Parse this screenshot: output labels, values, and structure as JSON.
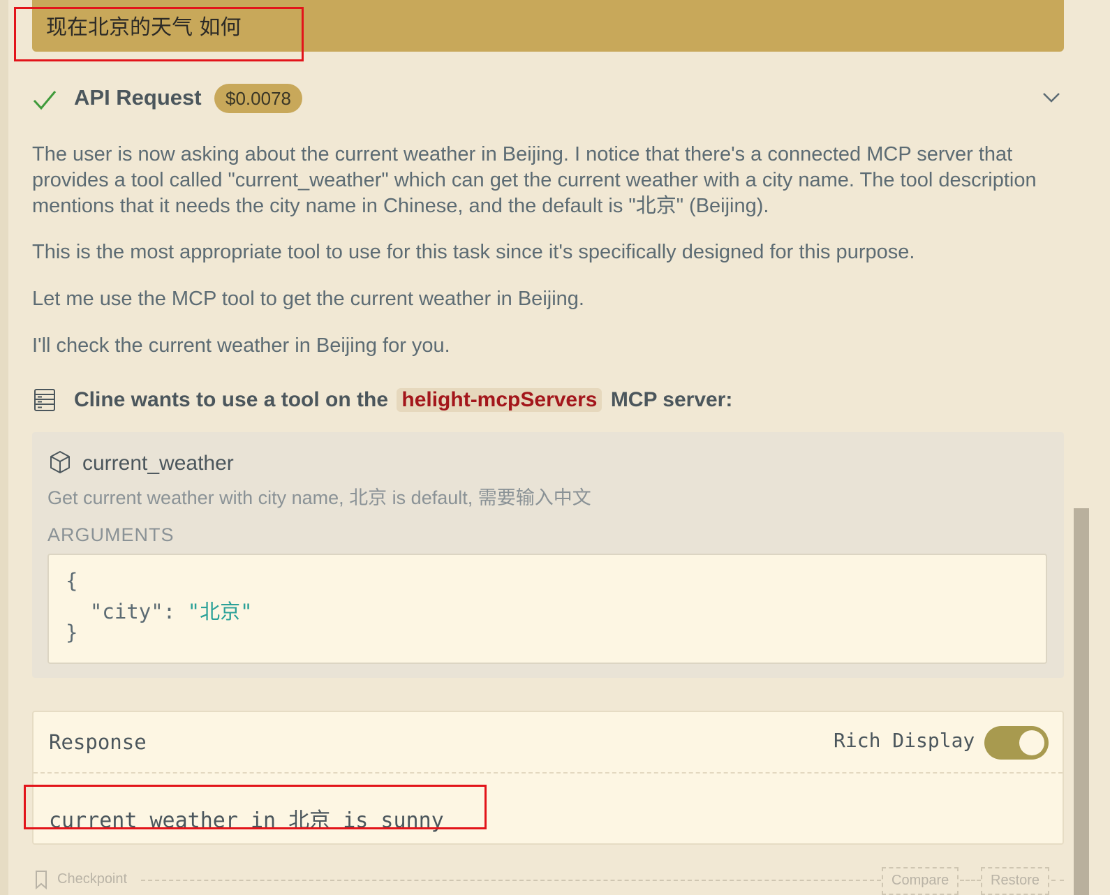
{
  "user_message": {
    "text": "现在北京的天气 如何"
  },
  "api_request": {
    "title": "API Request",
    "cost": "$0.0078"
  },
  "reasoning": {
    "paragraphs": [
      "The user is now asking about the current weather in Beijing. I notice that there's a connected MCP server that provides a tool called \"current_weather\" which can get the current weather with a city name. The tool description mentions that it needs the city name in Chinese, and the default is \"北京\" (Beijing).",
      "This is the most appropriate tool to use for this task since it's specifically designed for this purpose.",
      "Let me use the MCP tool to get the current weather in Beijing.",
      "I'll check the current weather in Beijing for you."
    ]
  },
  "mcp": {
    "prefix": "Cline wants to use a tool on the",
    "server_name": "helight-mcpServers",
    "suffix": "MCP server:"
  },
  "tool": {
    "name": "current_weather",
    "description": "Get current weather with city name, 北京 is default, 需要输入中文",
    "arguments_label": "ARGUMENTS",
    "arguments": {
      "open": "{",
      "key": "\"city\"",
      "colon": ": ",
      "value": "\"北京\"",
      "close": "}"
    }
  },
  "response": {
    "label": "Response",
    "rich_display_label": "Rich Display",
    "rich_display_on": true,
    "text": "current weather in 北京 is sunny"
  },
  "checkpoint": {
    "label": "Checkpoint",
    "compare_label": "Compare",
    "restore_label": "Restore"
  },
  "colors": {
    "accent": "#c8a85a",
    "server_name": "#a3161b",
    "string": "#2aa198",
    "highlight_box": "#e2141a"
  }
}
